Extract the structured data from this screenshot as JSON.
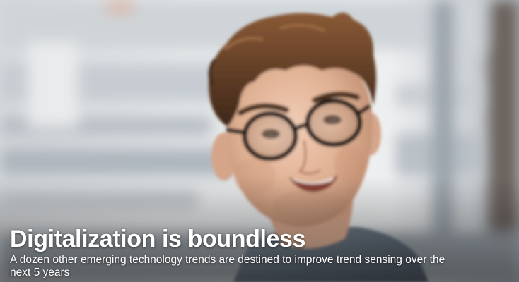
{
  "hero": {
    "headline": "Digitalization is boundless",
    "subheadline": "A dozen other emerging technology trends are destined to improve trend sensing over the next 5 years"
  },
  "image": {
    "subject": "smiling young man with dark-rimmed round glasses and tousled brown hair",
    "background": "blurred bright office interior"
  },
  "colors": {
    "text": "#ffffff",
    "hair": "#5b3a24",
    "skin": "#e2b79c",
    "shirt": "#5f6b78",
    "background": "#cfd3d6"
  }
}
